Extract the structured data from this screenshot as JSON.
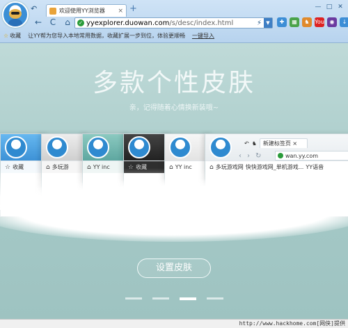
{
  "tab": {
    "title": "欢迎使用YY浏览器",
    "close": "×"
  },
  "newtab": "+",
  "window": {
    "min": "—",
    "max": "□",
    "close": "✕"
  },
  "nav": {
    "back_home": "↶",
    "back": "←",
    "refresh": "C",
    "home": "⌂"
  },
  "url": {
    "host": "yyexplorer.duowan.com",
    "path": "/s/desc/index.html",
    "bolt": "⚡",
    "dropdown": "▼"
  },
  "toolbar_icons": [
    {
      "name": "puzzle-icon",
      "label": "✚",
      "color": "#3d8ed6"
    },
    {
      "name": "grid-icon",
      "label": "▦",
      "color": "#4aa34a"
    },
    {
      "name": "game-icon",
      "label": "♞",
      "color": "#e08a2c"
    },
    {
      "name": "youtube-icon",
      "label": "You",
      "color": "#d22"
    },
    {
      "name": "media-icon",
      "label": "◉",
      "color": "#6b3aa0"
    },
    {
      "name": "download-icon",
      "label": "↓",
      "color": "#3d8ed6"
    }
  ],
  "bookmarks": {
    "star": "☆",
    "label": "收藏",
    "hint": "让YY帮为您导入本地常用数据，收藏扩展一步到位，体验更顺畅",
    "link": "一键导入"
  },
  "hero": {
    "title": "多款个性皮肤",
    "subtitle": "亲，记得随着心情换新装哦~"
  },
  "skins": [
    {
      "row": "收藏",
      "icon": "☆"
    },
    {
      "row": "多玩游",
      "icon": "⌂"
    },
    {
      "row": "YY inc",
      "icon": "⌂"
    },
    {
      "row": "收藏",
      "icon": "☆"
    },
    {
      "row": "YY inc",
      "icon": "⌂"
    }
  ],
  "skin6": {
    "tab_title": "新建标签页",
    "tab_close": "×",
    "url": "wan.yy.com",
    "bookmarks": [
      "多玩游戏网",
      "快快游戏网_单机游戏...",
      "YY语音"
    ]
  },
  "action": {
    "label": "设置皮肤"
  },
  "pagination": {
    "count": 4,
    "active_index": 2
  },
  "status": {
    "text": "http://www.hackhome.com[网侠]提供"
  }
}
